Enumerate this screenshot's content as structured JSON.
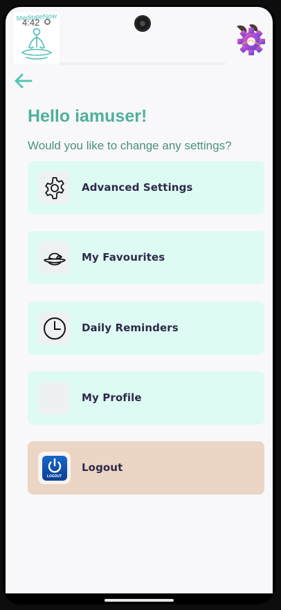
{
  "status_bar": {
    "time": "4:42"
  },
  "app": {
    "logo_text": "MeditateNow"
  },
  "header": {
    "greeting": "Hello iamuser!",
    "subtitle": "Would you like to change any settings?"
  },
  "menu": {
    "items": [
      {
        "label": "Advanced Settings",
        "icon": "gear-icon"
      },
      {
        "label": "My Favourites",
        "icon": "hat-icon"
      },
      {
        "label": "Daily Reminders",
        "icon": "clock-icon"
      },
      {
        "label": "My Profile",
        "icon": "profile-icon"
      },
      {
        "label": "Logout",
        "icon": "power-icon",
        "icon_text": "LOGOUT"
      }
    ]
  },
  "colors": {
    "accent": "#4fb09a",
    "card": "#defbf3",
    "logout_card": "#ebd5c4",
    "label": "#2c2a4a"
  }
}
